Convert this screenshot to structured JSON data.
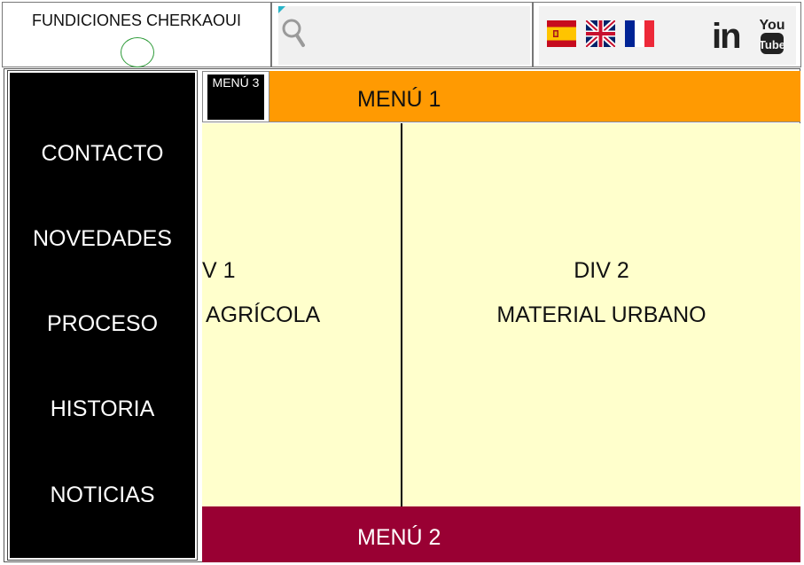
{
  "header": {
    "brand_title": "FUNDICIONES CHERKAOUI",
    "search": {
      "value": "",
      "placeholder": ""
    },
    "languages": [
      {
        "code": "es",
        "icon": "spain-flag-icon"
      },
      {
        "code": "en",
        "icon": "uk-flag-icon"
      },
      {
        "code": "fr",
        "icon": "france-flag-icon"
      }
    ],
    "social": {
      "linkedin_label": "in",
      "youtube_top": "You",
      "youtube_bottom": "Tube"
    }
  },
  "sidebar": {
    "items": [
      {
        "label": "CONTACTO"
      },
      {
        "label": "NOVEDADES"
      },
      {
        "label": "PROCESO"
      },
      {
        "label": "HISTORIA"
      },
      {
        "label": "NOTICIAS"
      }
    ]
  },
  "menus": {
    "menu1": "MENÚ 1",
    "menu2": "MENÚ 2",
    "menu3": "MENÚ 3"
  },
  "content": {
    "div1": {
      "title": "V 1",
      "subtitle": "AGRÍCOLA"
    },
    "div2": {
      "title": "DIV 2",
      "subtitle": "MATERIAL URBANO"
    }
  },
  "colors": {
    "menu1_bg": "#ff9a02",
    "menu2_bg": "#990033",
    "content_bg": "#ffffcc",
    "sidebar_bg": "#000000"
  }
}
